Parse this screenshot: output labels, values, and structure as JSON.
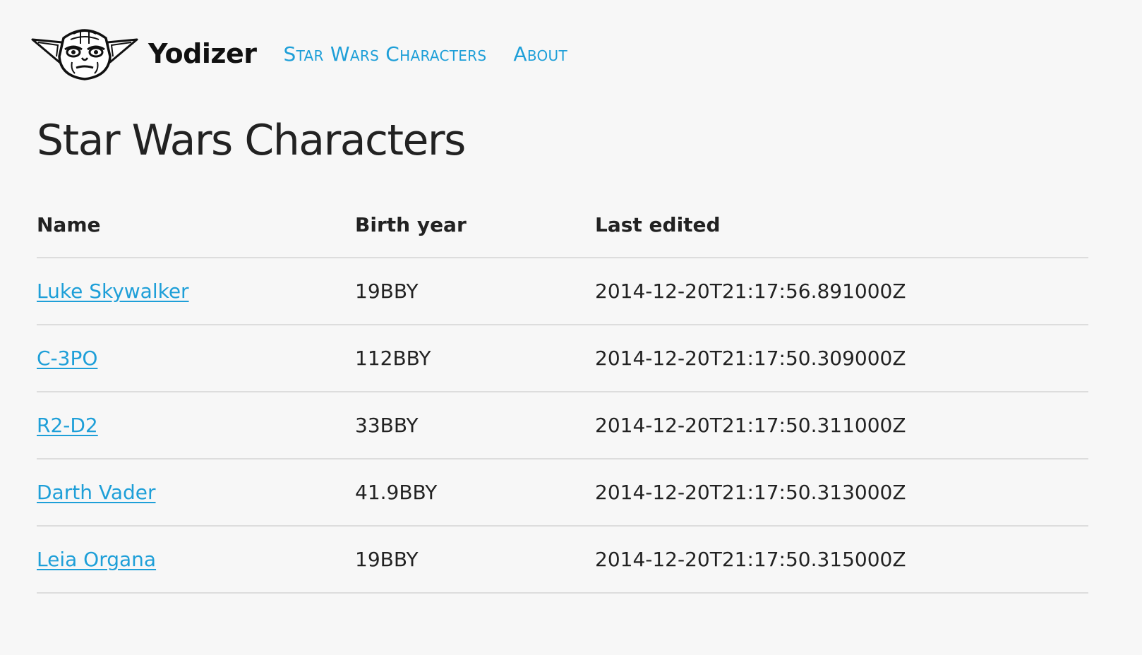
{
  "header": {
    "brand": "Yodizer",
    "nav": [
      {
        "label": "Star Wars Characters"
      },
      {
        "label": "About"
      }
    ]
  },
  "main": {
    "title": "Star Wars Characters",
    "table": {
      "columns": [
        "Name",
        "Birth year",
        "Last edited"
      ],
      "rows": [
        {
          "name": "Luke Skywalker",
          "birth_year": "19BBY",
          "edited": "2014-12-20T21:17:56.891000Z"
        },
        {
          "name": "C-3PO",
          "birth_year": "112BBY",
          "edited": "2014-12-20T21:17:50.309000Z"
        },
        {
          "name": "R2-D2",
          "birth_year": "33BBY",
          "edited": "2014-12-20T21:17:50.311000Z"
        },
        {
          "name": "Darth Vader",
          "birth_year": "41.9BBY",
          "edited": "2014-12-20T21:17:50.313000Z"
        },
        {
          "name": "Leia Organa",
          "birth_year": "19BBY",
          "edited": "2014-12-20T21:17:50.315000Z"
        }
      ]
    }
  },
  "theme": {
    "link_color": "#1e9fd8",
    "background": "#f7f7f7",
    "text_color": "#222222"
  },
  "icons": {
    "logo": "yoda-head-icon"
  }
}
